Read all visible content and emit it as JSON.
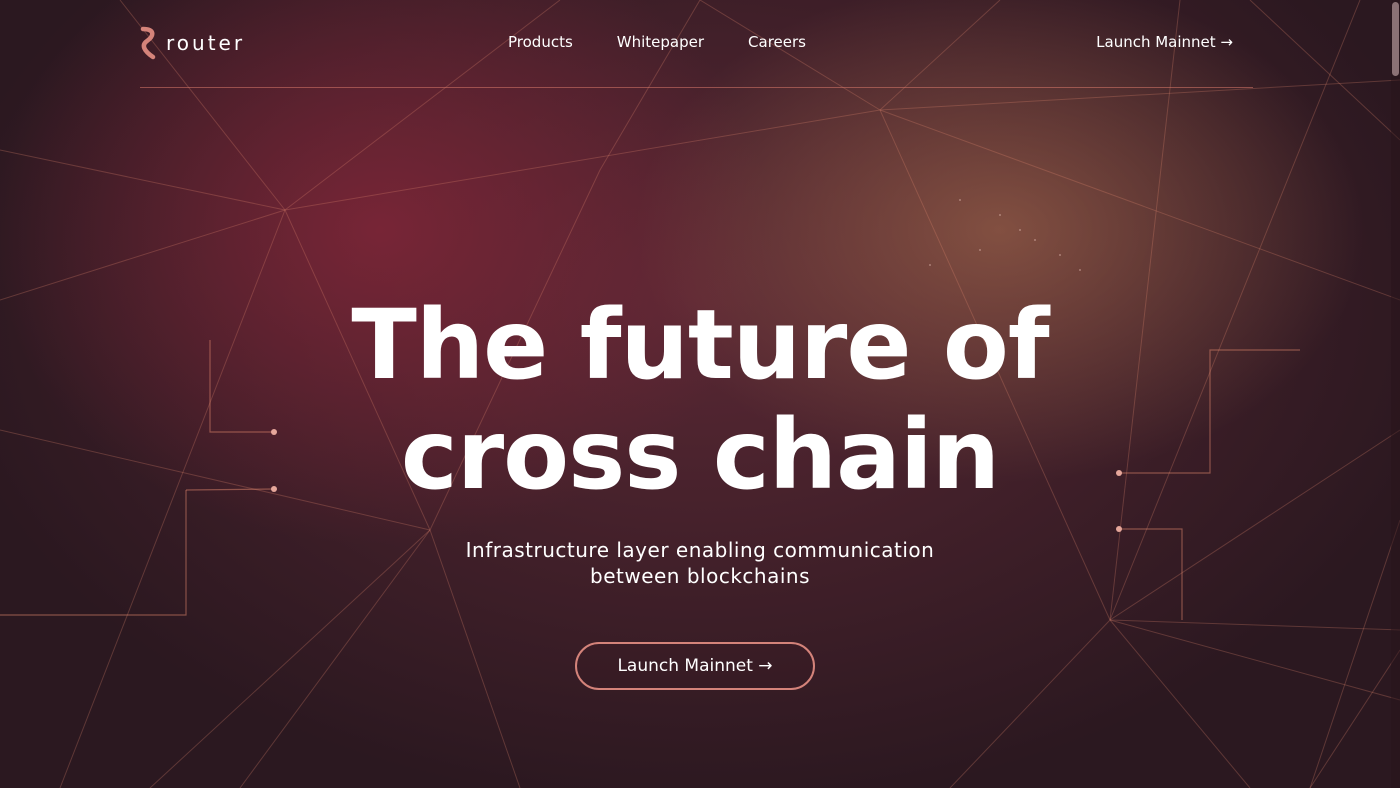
{
  "brand": {
    "name": "router",
    "accent_color": "#d4837a",
    "logo_icon": "router-logo-icon"
  },
  "nav": {
    "items": [
      {
        "label": "Products"
      },
      {
        "label": "Whitepaper"
      },
      {
        "label": "Careers"
      }
    ],
    "cta_label": "Launch Mainnet →"
  },
  "hero": {
    "title_line1": "The future of",
    "title_line2": "cross chain",
    "subtitle_line1": "Infrastructure layer enabling communication",
    "subtitle_line2": "between blockchains",
    "cta_label": "Launch Mainnet →"
  }
}
